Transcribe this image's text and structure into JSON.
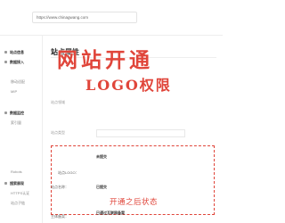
{
  "topbar": {
    "domain": "https://www.chinagwang.com",
    "links": [
      "",
      "",
      ""
    ]
  },
  "sidebar": {
    "items": [
      {
        "label": "站点信息",
        "type": "group"
      },
      {
        "label": "数据接入",
        "type": "group"
      },
      {
        "label": "",
        "type": "sub"
      },
      {
        "label": "移动适配",
        "type": "sub"
      },
      {
        "label": "MIP",
        "type": "sub"
      },
      {
        "label": "",
        "type": "sub"
      },
      {
        "label": "数据监控",
        "type": "group"
      },
      {
        "label": "索引量",
        "type": "sub"
      },
      {
        "label": "",
        "type": "sub"
      },
      {
        "label": "",
        "type": "sub"
      },
      {
        "label": "",
        "type": "sub"
      },
      {
        "label": "",
        "type": "sub"
      },
      {
        "label": "Robots",
        "type": "sub"
      },
      {
        "label": "搜索展现",
        "type": "group"
      },
      {
        "label": "HTTPS认证",
        "type": "sub"
      },
      {
        "label": "站点子链",
        "type": "sub"
      }
    ]
  },
  "main": {
    "section_title": "站点属性",
    "rows": [
      {
        "label": "站点领域",
        "value": ""
      },
      {
        "label": "",
        "value": ""
      },
      {
        "label": "站点类型",
        "value": ""
      }
    ],
    "logo": {
      "label": "站点LOGO：",
      "status": "未提交",
      "hints": [
        {
          "text": "",
          "style": "red"
        },
        {
          "text": "",
          "style": "red"
        },
        {
          "text": "",
          "style": "gray"
        },
        {
          "text": "",
          "style": "gray"
        }
      ],
      "after_open": "开通之后状态"
    },
    "bottom": {
      "label": "站点名称：",
      "value": "已提交",
      "desc": "",
      "label2": "主体备案：",
      "value2": "已通过互联网备案"
    }
  },
  "overlay": {
    "line1": "网站开通",
    "line2": "LOGO权限"
  },
  "colors": {
    "accent_red": "#e0453a",
    "text_dark": "#222222",
    "text_gray": "#999999"
  }
}
